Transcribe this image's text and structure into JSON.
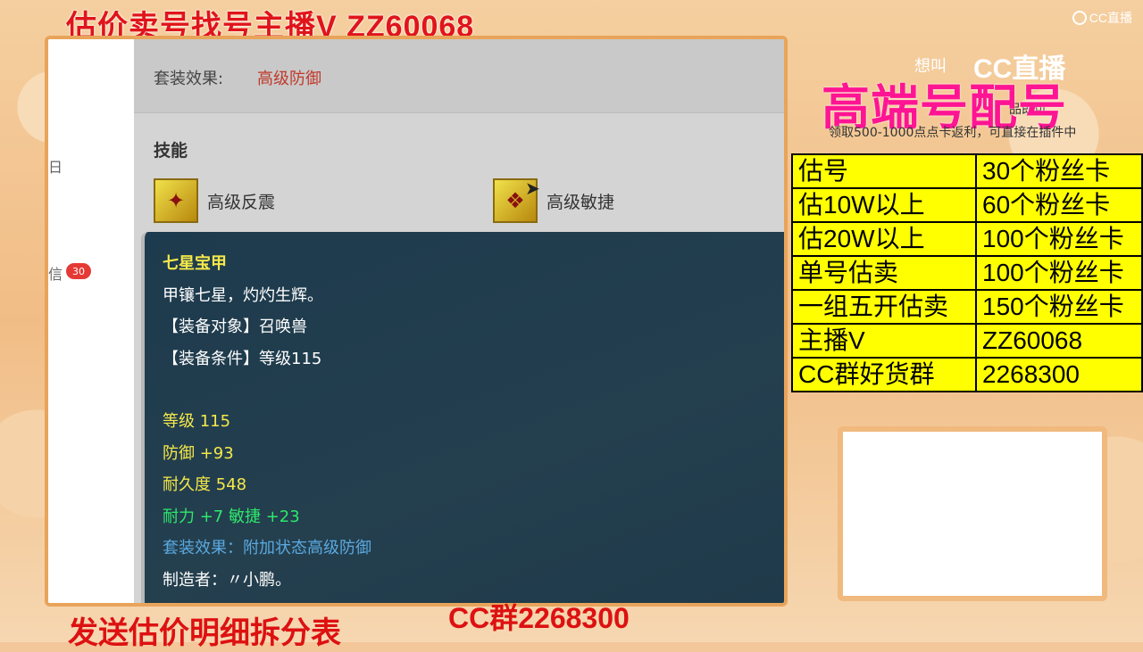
{
  "stream": {
    "top_title": "估价卖号找号主播V ZZ60068",
    "cc_logo_text": "CC直播",
    "bottom_left": "发送估价明细拆分表",
    "bottom_mid": "CC群2268300"
  },
  "sidebar": {
    "item1": "日",
    "item2": "信",
    "badge": "30"
  },
  "panel": {
    "set_label": "套装效果:",
    "set_value": "高级防御",
    "skills_title": "技能",
    "skills": [
      {
        "name": "高级反震"
      },
      {
        "name": "高级敏捷"
      }
    ]
  },
  "tooltip": {
    "name": "七星宝甲",
    "desc": "甲镶七星，灼灼生辉。",
    "target": "【装备对象】召唤兽",
    "condition": "【装备条件】等级115",
    "level": "等级 115",
    "defense": "防御 +93",
    "durability": "耐久度 548",
    "stats": "耐力 +7 敏捷 +23",
    "set_effect": "套装效果：附加状态高级防御",
    "maker": "制造者：〃小鹏。"
  },
  "right": {
    "big_title": "高端号配号",
    "promo_1": "想叫",
    "cc_logo": "CC直播",
    "promo_2": "品即可",
    "promo_3": "领取500-1000点点卡返利，可直接在插件中",
    "price_rows": [
      {
        "key": "估号",
        "value": "30个粉丝卡"
      },
      {
        "key": "估10W以上",
        "value": "60个粉丝卡"
      },
      {
        "key": "估20W以上",
        "value": "100个粉丝卡"
      },
      {
        "key": "单号估卖",
        "value": "100个粉丝卡"
      },
      {
        "key": "一组五开估卖",
        "value": "150个粉丝卡"
      },
      {
        "key": "主播V",
        "value": "ZZ60068"
      },
      {
        "key": "CC群好货群",
        "value": "2268300"
      }
    ]
  },
  "colors": {
    "title_red": "#e0141a",
    "pink": "#ff1493",
    "table_yellow": "#ffff00",
    "tooltip_bg": "#1f3a4a",
    "item_name_yellow": "#f5e84a",
    "stat_green": "#2ee86c",
    "set_blue": "#5aa9e0"
  }
}
